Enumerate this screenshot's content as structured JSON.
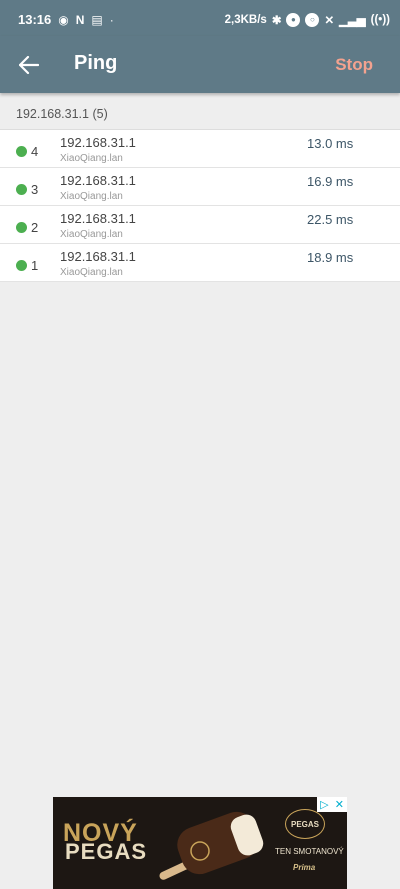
{
  "status_bar": {
    "time": "13:16",
    "carrier_icons": [
      "chrome-icon",
      "n-icon",
      "calendar-icon"
    ],
    "speed": "2,3KB/s"
  },
  "app_bar": {
    "title": "Ping",
    "stop_label": "Stop"
  },
  "group_header": "192.168.31.1 (5)",
  "ping_results": [
    {
      "seq": "4",
      "host": "192.168.31.1",
      "hostname": "XiaoQiang.lan",
      "time": "13.0 ms"
    },
    {
      "seq": "3",
      "host": "192.168.31.1",
      "hostname": "XiaoQiang.lan",
      "time": "16.9 ms"
    },
    {
      "seq": "2",
      "host": "192.168.31.1",
      "hostname": "XiaoQiang.lan",
      "time": "22.5 ms"
    },
    {
      "seq": "1",
      "host": "192.168.31.1",
      "hostname": "XiaoQiang.lan",
      "time": "18.9 ms"
    }
  ],
  "ad": {
    "headline_1": "NOVÝ",
    "headline_2": "PEGAS",
    "logo": "PEGAS",
    "slogan": "TEN SMOTANOVÝ",
    "sub_brand": "Prima"
  },
  "colors": {
    "app_bar": "#5f7a87",
    "stop_accent": "#f3a28f",
    "status_dot": "#4caf50",
    "progress": "#3fb34f"
  }
}
